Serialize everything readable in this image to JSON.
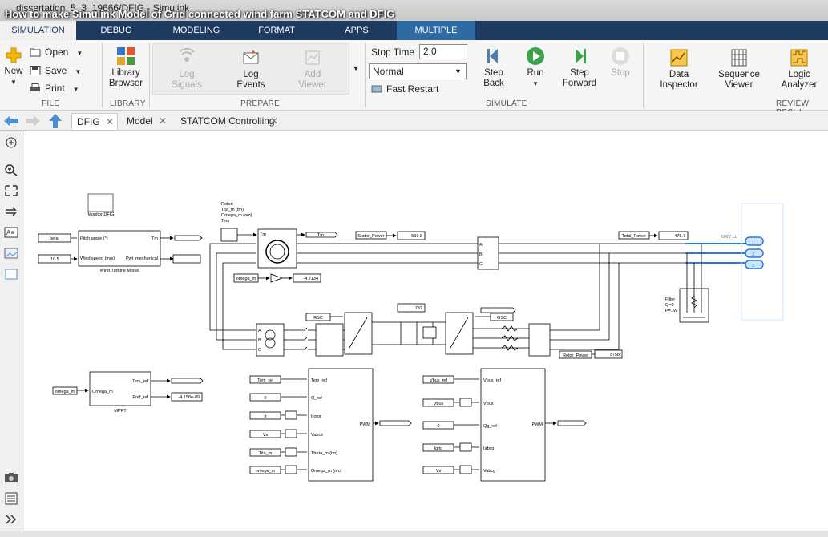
{
  "window": {
    "title": "dissertation_5_3_19666/DFIG - Simulink",
    "video_overlay_title": "How to make Simulink Model of Grid connected wind farm STATCOM and DFIG"
  },
  "tabs": [
    "SIMULATION",
    "DEBUG",
    "MODELING",
    "FORMAT",
    "APPS",
    "MULTIPLE"
  ],
  "ribbon": {
    "file": {
      "new": "New",
      "open": "Open",
      "save": "Save",
      "print": "Print",
      "group": "FILE"
    },
    "library": {
      "browser_line1": "Library",
      "browser_line2": "Browser",
      "group": "LIBRARY"
    },
    "prepare": {
      "log_signals_1": "Log",
      "log_signals_2": "Signals",
      "log_events_1": "Log",
      "log_events_2": "Events",
      "add_viewer_1": "Add",
      "add_viewer_2": "Viewer",
      "group": "PREPARE"
    },
    "simulate": {
      "stop_time_label": "Stop Time",
      "stop_time_value": "2.0",
      "mode": "Normal",
      "fast_restart": "Fast Restart",
      "step_back_1": "Step",
      "step_back_2": "Back",
      "run": "Run",
      "step_forward_1": "Step",
      "step_forward_2": "Forward",
      "stop": "Stop",
      "group": "SIMULATE"
    },
    "review": {
      "data_inspector_1": "Data",
      "data_inspector_2": "Inspector",
      "sequence_viewer_1": "Sequence",
      "sequence_viewer_2": "Viewer",
      "logic_analyzer_1": "Logic",
      "logic_analyzer_2": "Analyzer",
      "group": "REVIEW RESUL"
    }
  },
  "model_tabs": [
    {
      "label": "DFIG"
    },
    {
      "label": "Model"
    },
    {
      "label": "STATCOM Controlling"
    }
  ],
  "diagram": {
    "monitor_dfig": "Monitor DFIG",
    "beta": "beta",
    "wind_speed_value": "10.5",
    "wind_turbine_pitch": "Pitch angle (°)",
    "wind_turbine_speed": "Wind speed (m/s)",
    "wind_turbine_tm": "Tm",
    "wind_turbine_pout": "Pwt_mechanical",
    "wind_turbine_name": "Wind Turbine Model",
    "rotor_measure": [
      "Rotor:",
      "Tita_m (tm)",
      "Omega_m (om)",
      "Tem"
    ],
    "tm_tag": "Tm",
    "stator_power_tag": "Stator_Power",
    "stator_power_display": "569.8",
    "omega_m_tag": "omega_m",
    "omega_m_display": "-4.2134",
    "total_power_tag": "Total_Power",
    "total_power_display": "475.7",
    "source_label": "690V, LL",
    "filter_label": [
      "Filter",
      "Q=0",
      "P=1W"
    ],
    "vdc_display": "787",
    "rsc_tag": "RSC",
    "gsc_tag": "GSC",
    "rotor_power_tag": "Rotor_Power",
    "rotor_power_display": "3758",
    "mppt_in": "omega_m",
    "mppt_port_in": "Omega_m",
    "mppt_port_tem": "Tem_ref",
    "mppt_port_pref": "Pref_ref",
    "mppt_name": "MPPT",
    "mppt_display": "-4.158e-09",
    "rsc_inputs": [
      "Tem_ref",
      "0",
      "Ir",
      "Vs",
      "Tita_m",
      "omega_m"
    ],
    "rsc_ports": [
      "Tem_ref",
      "Q_ref",
      "Irotor",
      "Vabcs",
      "Theta_m (tm)",
      "Omega_m (om)"
    ],
    "rsc_out": "PWM",
    "gsc_inputs": [
      "Vbus_ref",
      "Vbus",
      "0",
      "Igrid",
      "Vs"
    ],
    "gsc_ports": [
      "Vbus_ref",
      "Vbus",
      "Qg_ref",
      "Iabcg",
      "Vabcg"
    ],
    "gsc_out": "PWM",
    "abc": [
      "A",
      "B",
      "C"
    ],
    "abc_lower": [
      "a",
      "b",
      "c"
    ]
  }
}
